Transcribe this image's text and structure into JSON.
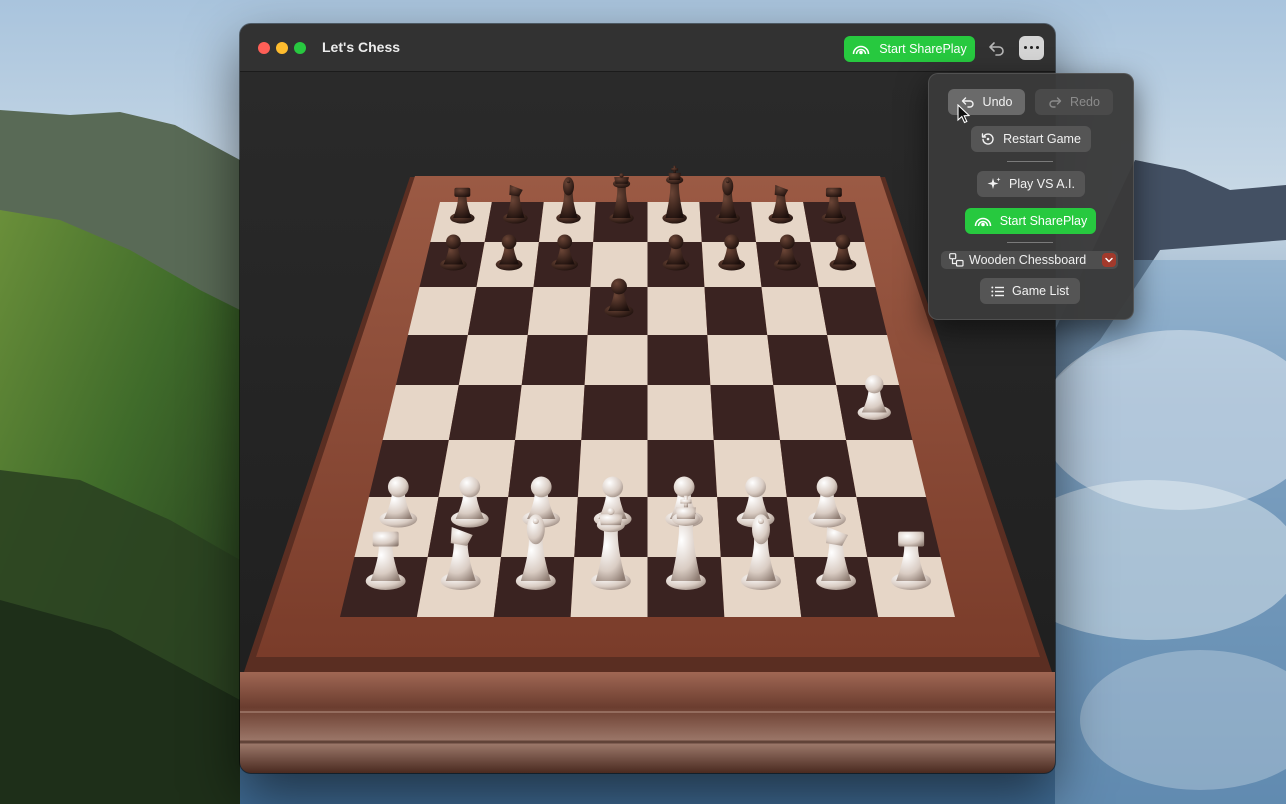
{
  "window": {
    "title": "Let's Chess",
    "toolbar": {
      "shareplay_label": "Start SharePlay"
    }
  },
  "menu": {
    "undo_label": "Undo",
    "redo_label": "Redo",
    "restart_label": "Restart Game",
    "play_ai_label": "Play VS A.I.",
    "shareplay_label": "Start SharePlay",
    "board_style": "Wooden Chessboard",
    "game_list_label": "Game List"
  },
  "board": {
    "dark_pieces": [
      "rook",
      "knight",
      "bishop",
      "queen",
      "king",
      "bishop",
      "knight",
      "rook",
      "pawn",
      "pawn",
      "pawn",
      "pawn",
      "pawn",
      "pawn",
      "pawn",
      "pawn"
    ],
    "light_pieces": [
      "rook",
      "knight",
      "bishop",
      "queen",
      "king",
      "bishop",
      "knight",
      "rook",
      "pawn",
      "pawn",
      "pawn",
      "pawn",
      "pawn",
      "pawn",
      "pawn",
      "pawn"
    ]
  },
  "colors": {
    "shareplay_green": "#27c93f",
    "board_frame": "#8a4a35",
    "light_square": "#e6d6c7",
    "dark_square": "#3a2321"
  },
  "icons": [
    "shareplay-icon",
    "undo-icon",
    "more-icon",
    "redo-icon",
    "restart-icon",
    "sparkle-icon",
    "board-icon",
    "chevron-down-icon",
    "list-icon",
    "cursor-icon"
  ]
}
